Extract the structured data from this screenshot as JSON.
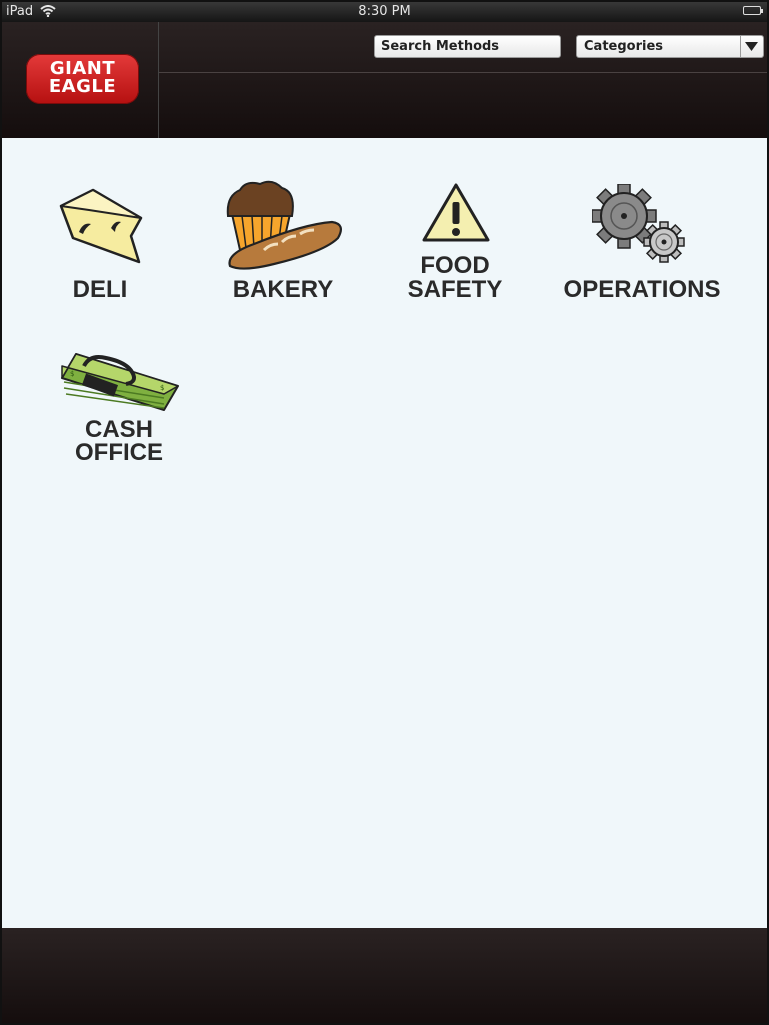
{
  "status_bar": {
    "device": "iPad",
    "time": "8:30 PM"
  },
  "header": {
    "logo": {
      "line1": "GIANT",
      "line2": "EAGLE"
    },
    "search": {
      "placeholder": "Search Methods"
    },
    "categories": {
      "selected": "Categories"
    }
  },
  "tiles": [
    {
      "label_line1": "DELI",
      "label_line2": "",
      "icon": "cheese-icon"
    },
    {
      "label_line1": "BAKERY",
      "label_line2": "",
      "icon": "bakery-icon"
    },
    {
      "label_line1": "FOOD",
      "label_line2": "SAFETY",
      "icon": "warning-icon"
    },
    {
      "label_line1": "OPERATIONS",
      "label_line2": "",
      "icon": "gears-icon"
    },
    {
      "label_line1": "CASH",
      "label_line2": "OFFICE",
      "icon": "money-icon"
    }
  ],
  "colors": {
    "content_bg": "#f0f7fa",
    "header_bg": "#1c1414",
    "logo_red": "#d42525",
    "label_text": "#2a2a2a"
  }
}
